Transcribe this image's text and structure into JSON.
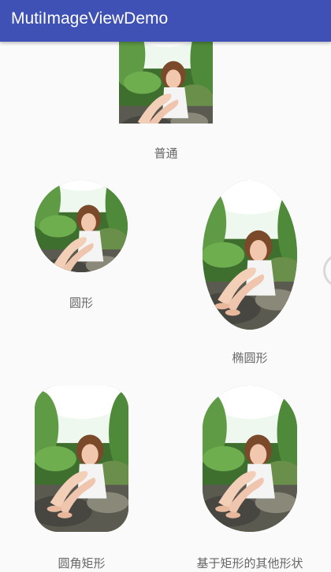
{
  "app": {
    "title": "MutiImageViewDemo"
  },
  "images": {
    "normal": {
      "caption": "普通"
    },
    "circle": {
      "caption": "圆形"
    },
    "ellipse": {
      "caption": "椭圆形"
    },
    "rounded_rect": {
      "caption": "圆角矩形"
    },
    "rect_based_shape": {
      "caption": "基于矩形的其他形状"
    }
  }
}
